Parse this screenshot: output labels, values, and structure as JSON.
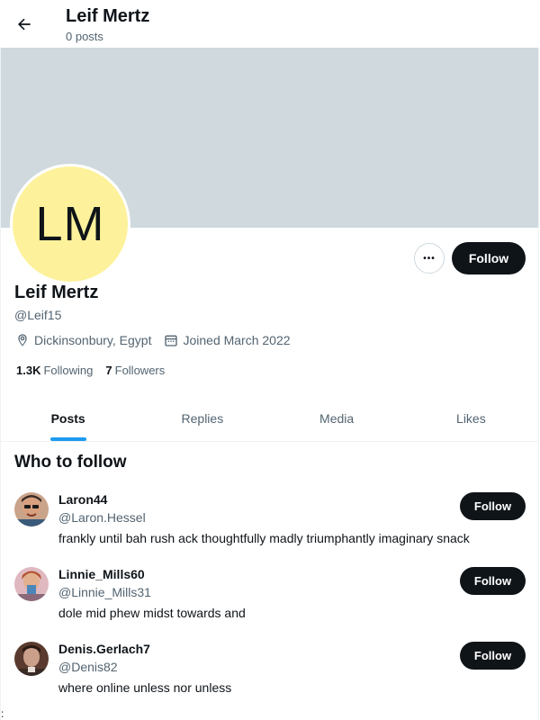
{
  "header": {
    "title": "Leif Mertz",
    "subtitle": "0 posts"
  },
  "profile": {
    "avatar_initials": "LM",
    "name": "Leif Mertz",
    "handle": "@Leif15",
    "location": "Dickinsonbury, Egypt",
    "joined": "Joined March 2022",
    "following_count": "1.3K",
    "following_label": "Following",
    "followers_count": "7",
    "followers_label": "Followers",
    "follow_label": "Follow",
    "more_label": "•••"
  },
  "tabs": [
    {
      "label": "Posts",
      "active": true
    },
    {
      "label": "Replies",
      "active": false
    },
    {
      "label": "Media",
      "active": false
    },
    {
      "label": "Likes",
      "active": false
    }
  ],
  "who_to_follow": {
    "title": "Who to follow",
    "items": [
      {
        "name": "Laron44",
        "handle": "@Laron.Hessel",
        "bio": "frankly until bah rush ack thoughtfully madly triumphantly imaginary snack",
        "follow_label": "Follow"
      },
      {
        "name": "Linnie_Mills60",
        "handle": "@Linnie_Mills31",
        "bio": "dole mid phew midst towards and",
        "follow_label": "Follow"
      },
      {
        "name": "Denis.Gerlach7",
        "handle": "@Denis82",
        "bio": "where online unless nor unless",
        "follow_label": "Follow"
      }
    ]
  },
  "footer_glyph": ":",
  "colors": {
    "accent": "#1d9bf0",
    "banner": "#cfd9de",
    "avatar_bg": "#fdf29b",
    "button_bg": "#0f1419"
  }
}
